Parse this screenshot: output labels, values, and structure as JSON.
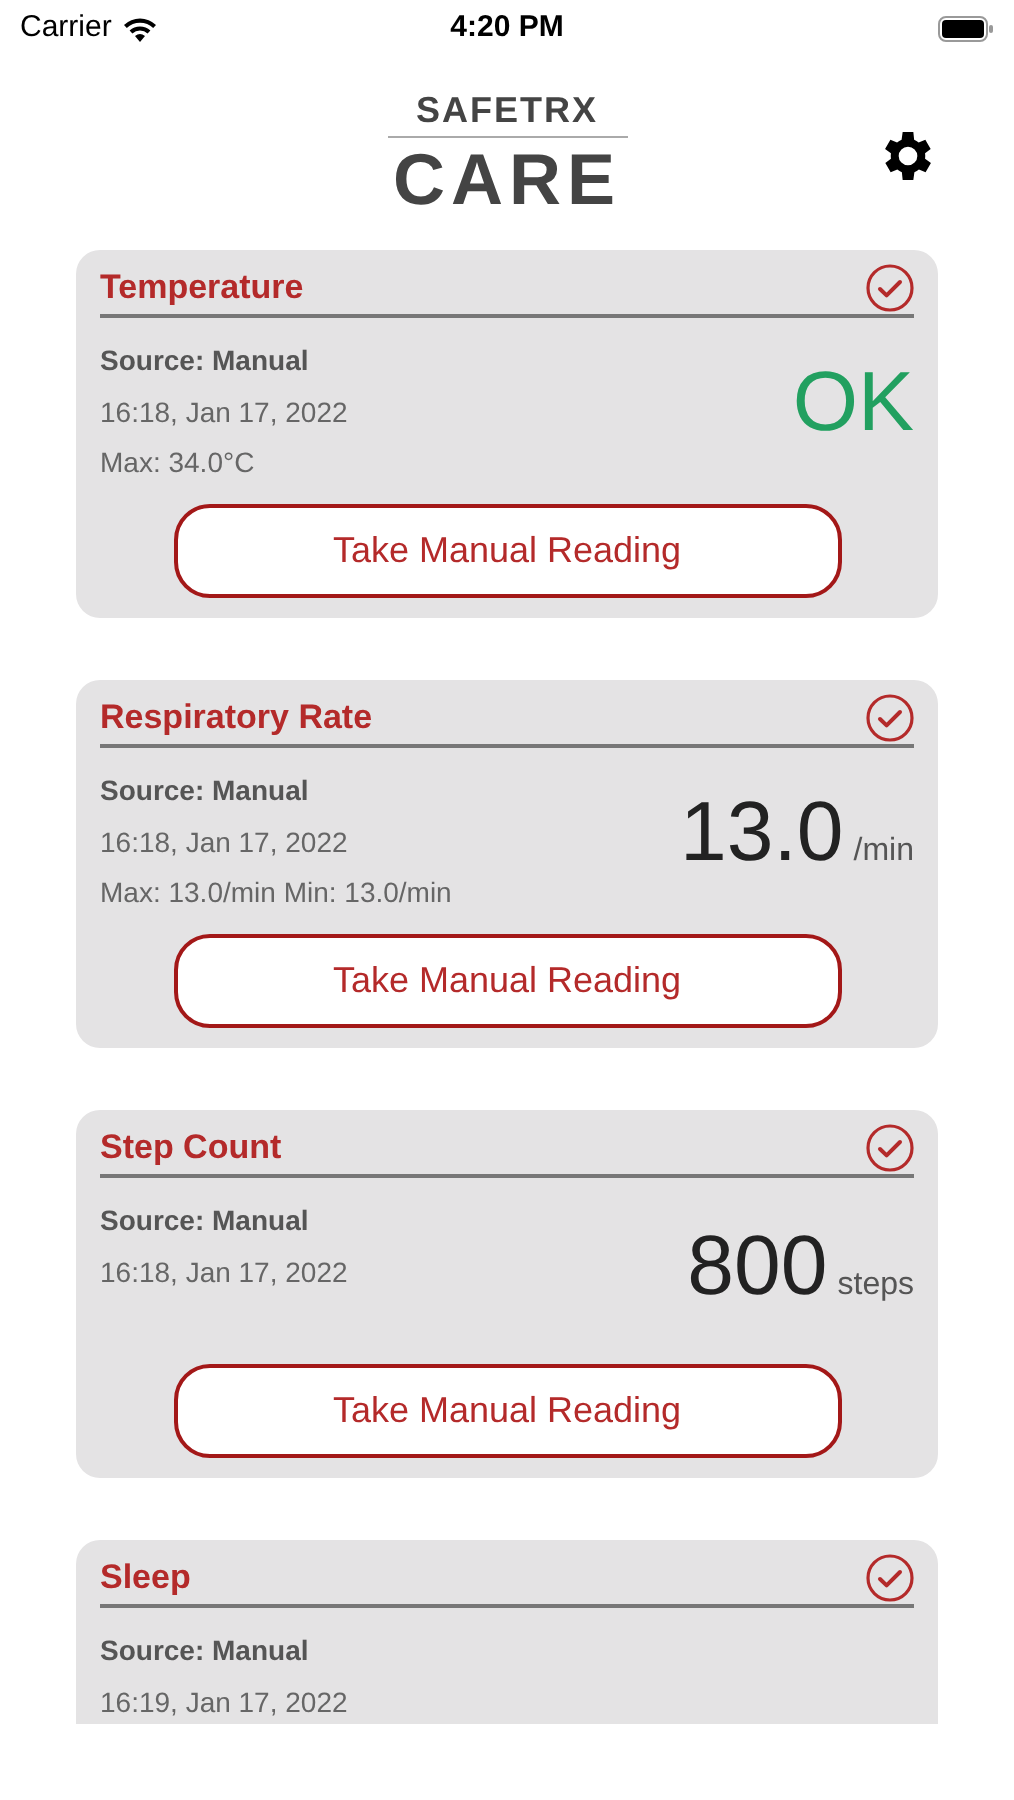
{
  "status_bar": {
    "carrier": "Carrier",
    "time": "4:20 PM"
  },
  "logo": {
    "top": "SAFETRX",
    "bottom": "CARE"
  },
  "cards": [
    {
      "title": "Temperature",
      "checked": true,
      "lines": [
        "Source: Manual",
        "16:18, Jan 17, 2022",
        "Max: 34.0°C"
      ],
      "reading": [
        {
          "value": "OK",
          "kind": "status"
        }
      ],
      "button": "Take Manual Reading"
    },
    {
      "title": "Respiratory Rate",
      "checked": true,
      "lines": [
        "Source: Manual",
        "16:18, Jan 17, 2022",
        "Max: 13.0/min Min: 13.0/min"
      ],
      "reading": [
        {
          "value": "13.0",
          "unit": "/min",
          "kind": "number"
        }
      ],
      "button": "Take Manual Reading"
    },
    {
      "title": "Step Count",
      "checked": true,
      "lines": [
        "Source: Manual",
        "16:18, Jan 17, 2022"
      ],
      "reading": [
        {
          "value": "800",
          "unit": "steps",
          "kind": "number"
        }
      ],
      "button": "Take Manual Reading"
    },
    {
      "title": "Sleep",
      "checked": true,
      "lines": [
        "Source: Manual",
        "16:19, Jan 17, 2022"
      ]
    }
  ]
}
